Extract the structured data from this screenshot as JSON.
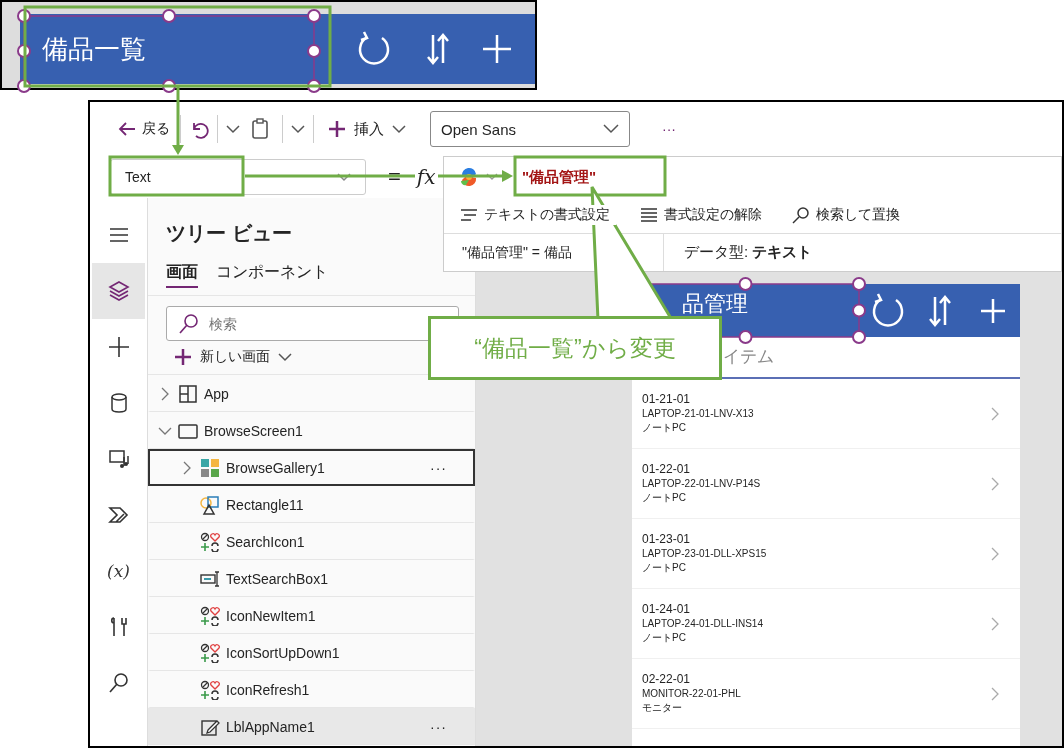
{
  "inset": {
    "title": "備品一覧"
  },
  "toolbar": {
    "back": "戻る",
    "insert": "挿入",
    "font": "Open Sans",
    "more": "···"
  },
  "formula_bar": {
    "property": "Text",
    "equals": "=",
    "fx": "fx",
    "formula": "\"備品管理\"",
    "tools": [
      {
        "kind": "format",
        "label": "テキストの書式設定"
      },
      {
        "kind": "clear",
        "label": "書式設定の解除"
      },
      {
        "kind": "search",
        "label": "検索して置換"
      }
    ],
    "result": "\"備品管理\"  =  備品",
    "data_type": "データ型: **テキスト**"
  },
  "rail": [
    {
      "kind": "menu",
      "selected": false
    },
    {
      "kind": "layers",
      "selected": true
    },
    {
      "kind": "plus",
      "selected": false
    },
    {
      "kind": "data",
      "selected": false
    },
    {
      "kind": "media",
      "selected": false
    },
    {
      "kind": "flow",
      "selected": false
    },
    {
      "kind": "variables",
      "label": "(x)",
      "selected": false
    },
    {
      "kind": "tools",
      "selected": false
    },
    {
      "kind": "search",
      "selected": false
    }
  ],
  "tree_view": {
    "title": "ツリー ビュー",
    "tabs": [
      {
        "label": "画面",
        "selected": true
      },
      {
        "label": "コンポーネント",
        "selected": false
      }
    ],
    "search": {
      "placeholder": "検索"
    },
    "new_screen": "新しい画面",
    "items": [
      {
        "kind": "app",
        "label": "App",
        "expanded": false,
        "selected": false,
        "hovered": false
      },
      {
        "kind": "screen",
        "label": "BrowseScreen1",
        "expanded": true,
        "selected": false,
        "hovered": false,
        "children": [
          {
            "kind": "gallery",
            "label": "BrowseGallery1",
            "expanded": false,
            "selected": true,
            "hovered": false,
            "more": "···"
          },
          {
            "kind": "rectangle",
            "label": "Rectangle11",
            "selected": false,
            "hovered": false
          },
          {
            "kind": "icon",
            "label": "SearchIcon1",
            "selected": false,
            "hovered": false
          },
          {
            "kind": "textinput",
            "label": "TextSearchBox1",
            "selected": false,
            "hovered": false
          },
          {
            "kind": "icon",
            "label": "IconNewItem1",
            "selected": false,
            "hovered": false
          },
          {
            "kind": "icon",
            "label": "IconSortUpDown1",
            "selected": false,
            "hovered": false
          },
          {
            "kind": "icon",
            "label": "IconRefresh1",
            "selected": false,
            "hovered": false
          },
          {
            "kind": "label",
            "label": "LblAppName1",
            "selected": false,
            "hovered": true,
            "more": "···"
          }
        ]
      }
    ]
  },
  "preview": {
    "title": "品管理",
    "search_placeholder": "イテム",
    "items": [
      {
        "title": "01-21-01",
        "code": "LAPTOP-21-01-LNV-X13",
        "category": "ノートPC"
      },
      {
        "title": "01-22-01",
        "code": "LAPTOP-22-01-LNV-P14S",
        "category": "ノートPC"
      },
      {
        "title": "01-23-01",
        "code": "LAPTOP-23-01-DLL-XPS15",
        "category": "ノートPC"
      },
      {
        "title": "01-24-01",
        "code": "LAPTOP-24-01-DLL-INS14",
        "category": "ノートPC"
      },
      {
        "title": "02-22-01",
        "code": "MONITOR-22-01-PHL",
        "category": "モニター"
      }
    ]
  },
  "annotation": {
    "callout": "“備品一覧”から変更"
  }
}
